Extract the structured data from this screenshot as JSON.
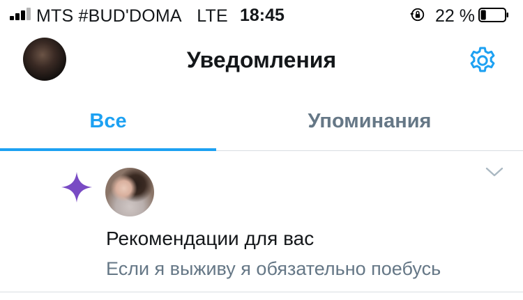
{
  "status_bar": {
    "carrier": "MTS #BUD'DOMA",
    "network": "LTE",
    "time": "18:45",
    "battery_percent": "22 %",
    "battery_level": 0.22,
    "signal_bars_filled": 3,
    "signal_bars_total": 4
  },
  "header": {
    "title": "Уведомления",
    "settings_icon": "gear-icon",
    "avatar_icon": "profile-avatar"
  },
  "tabs": [
    {
      "label": "Все",
      "active": true
    },
    {
      "label": "Упоминания",
      "active": false
    }
  ],
  "notification": {
    "icon": "sparkle-icon",
    "title": "Рекомендации для вас",
    "text": "Если я выживу я обязательно поебусь",
    "menu_icon": "chevron-down-icon"
  },
  "colors": {
    "accent": "#1da1f2",
    "secondary_text": "#657786",
    "sparkle": "#794bc4",
    "divider": "#d8dde2"
  }
}
